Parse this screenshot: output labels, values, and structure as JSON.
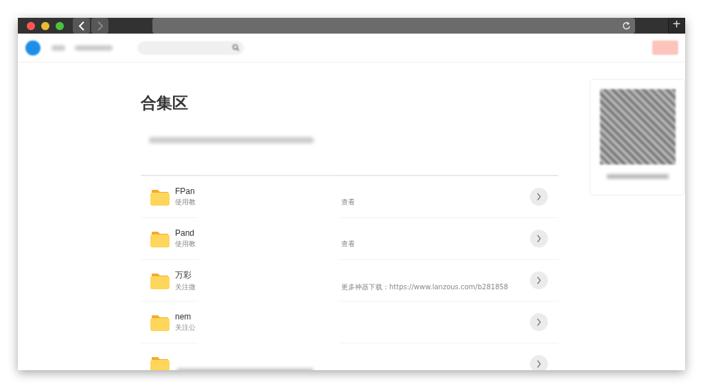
{
  "browser": {
    "new_tab_button": "+"
  },
  "page": {
    "title": "合集区",
    "folders": [
      {
        "title": "FPan",
        "subtitle": "使用教",
        "subtitle_tail": "查看"
      },
      {
        "title": "Pand",
        "subtitle": "使用教",
        "subtitle_tail": "查看"
      },
      {
        "title": "万彩",
        "subtitle": "关注微",
        "subtitle_tail": "更多神器下载：https://www.lanzous.com/b281858"
      },
      {
        "title": "nem",
        "subtitle": "关注公"
      },
      {
        "kind": "partial"
      }
    ]
  }
}
